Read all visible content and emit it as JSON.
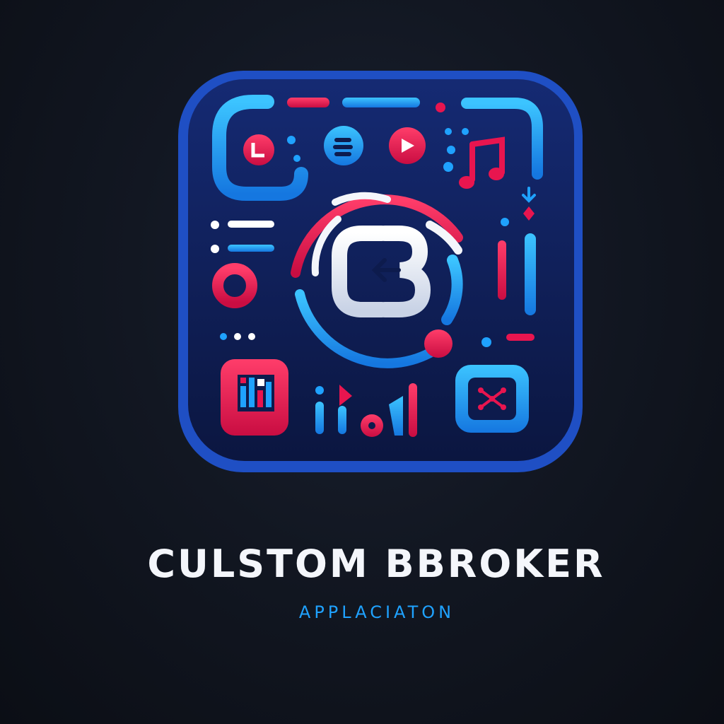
{
  "logo": {
    "title": "CULSTOM BBROKER",
    "subtitle": "APPLACIATON",
    "monogram_icon": "cb-monogram-icon",
    "colors": {
      "background": "#0f131c",
      "tile": "#0d1b4d",
      "tile_border": "#1f5ed9",
      "accent_blue": "#1fa2ff",
      "accent_red": "#e8154f",
      "text": "#f4f6fb"
    },
    "icons": [
      "play-button-icon",
      "menu-button-icon",
      "music-note-icon",
      "record-ring-icon",
      "equalizer-icon",
      "connection-node-icon",
      "audio-bars-icon"
    ]
  }
}
